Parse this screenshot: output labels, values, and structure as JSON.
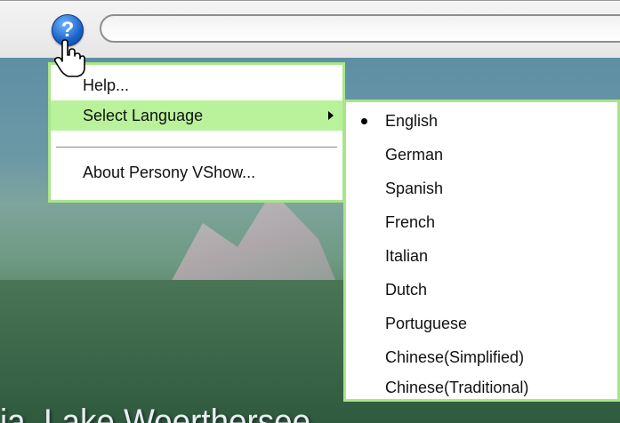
{
  "toolbar": {
    "help_icon_glyph": "?",
    "address_value": ""
  },
  "photo": {
    "caption": "ia, Lake Woerthersee"
  },
  "menu": {
    "items": [
      {
        "label": "Help..."
      },
      {
        "label": "Select Language",
        "has_submenu": true,
        "highlighted": true
      },
      {
        "label": "About Persony VShow..."
      }
    ]
  },
  "language_submenu": {
    "selected": "English",
    "items": [
      {
        "label": "English"
      },
      {
        "label": "German"
      },
      {
        "label": "Spanish"
      },
      {
        "label": "French"
      },
      {
        "label": "Italian"
      },
      {
        "label": "Dutch"
      },
      {
        "label": "Portuguese"
      },
      {
        "label": "Chinese(Simplified)"
      },
      {
        "label": "Chinese(Traditional)"
      }
    ]
  },
  "colors": {
    "menu_border": "#a8e68a",
    "menu_highlight": "#b9f29a",
    "help_icon_blue": "#1a63c8"
  }
}
